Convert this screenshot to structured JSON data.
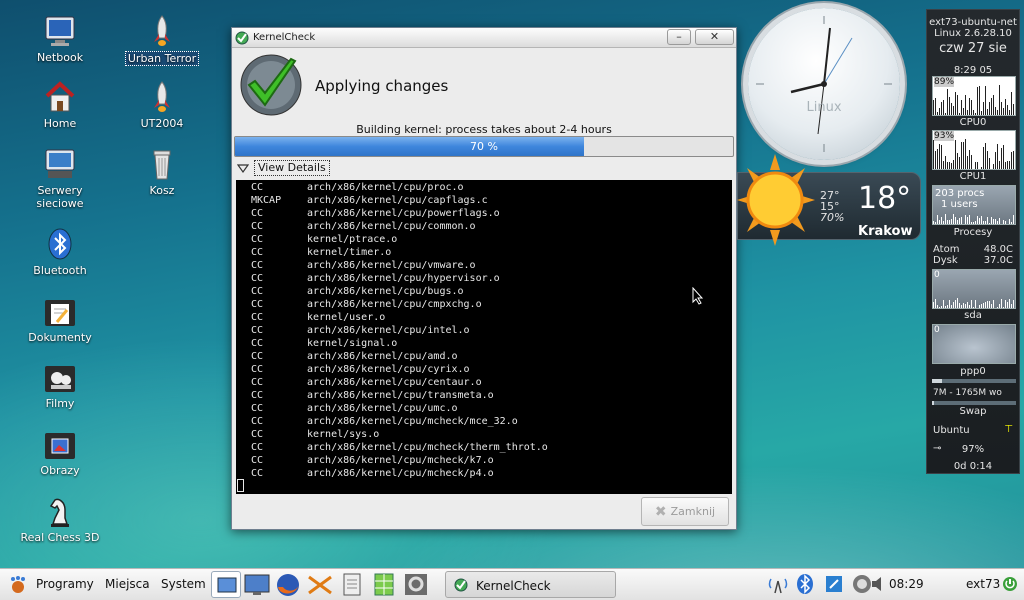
{
  "desktop": {
    "icons": [
      {
        "label": "Netbook"
      },
      {
        "label": "Urban Terror"
      },
      {
        "label": "Home"
      },
      {
        "label": "UT2004"
      },
      {
        "label": "Serwery sieciowe"
      },
      {
        "label": "Kosz"
      },
      {
        "label": "Bluetooth"
      },
      {
        "label": "Dokumenty"
      },
      {
        "label": "Filmy"
      },
      {
        "label": "Obrazy"
      },
      {
        "label": "Real Chess 3D"
      }
    ]
  },
  "window": {
    "title": "KernelCheck",
    "heading": "Applying changes",
    "status": "Building kernel: process takes about 2-4 hours",
    "progress": {
      "value": 0.7,
      "label": "70 %"
    },
    "expander_label": "View Details",
    "close_button": "Zamknij",
    "log": [
      [
        "CC",
        "arch/x86/kernel/cpu/proc.o"
      ],
      [
        "MKCAP",
        "arch/x86/kernel/cpu/capflags.c"
      ],
      [
        "CC",
        "arch/x86/kernel/cpu/powerflags.o"
      ],
      [
        "CC",
        "arch/x86/kernel/cpu/common.o"
      ],
      [
        "CC",
        "kernel/ptrace.o"
      ],
      [
        "CC",
        "kernel/timer.o"
      ],
      [
        "CC",
        "arch/x86/kernel/cpu/vmware.o"
      ],
      [
        "CC",
        "arch/x86/kernel/cpu/hypervisor.o"
      ],
      [
        "CC",
        "arch/x86/kernel/cpu/bugs.o"
      ],
      [
        "CC",
        "arch/x86/kernel/cpu/cmpxchg.o"
      ],
      [
        "CC",
        "kernel/user.o"
      ],
      [
        "CC",
        "arch/x86/kernel/cpu/intel.o"
      ],
      [
        "CC",
        "kernel/signal.o"
      ],
      [
        "CC",
        "arch/x86/kernel/cpu/amd.o"
      ],
      [
        "CC",
        "arch/x86/kernel/cpu/cyrix.o"
      ],
      [
        "CC",
        "arch/x86/kernel/cpu/centaur.o"
      ],
      [
        "CC",
        "arch/x86/kernel/cpu/transmeta.o"
      ],
      [
        "CC",
        "arch/x86/kernel/cpu/umc.o"
      ],
      [
        "CC",
        "arch/x86/kernel/cpu/mcheck/mce_32.o"
      ],
      [
        "CC",
        "kernel/sys.o"
      ],
      [
        "CC",
        "arch/x86/kernel/cpu/mcheck/therm_throt.o"
      ],
      [
        "CC",
        "arch/x86/kernel/cpu/mcheck/k7.o"
      ],
      [
        "CC",
        "arch/x86/kernel/cpu/mcheck/p4.o"
      ]
    ]
  },
  "clock": {
    "brand": "Linux",
    "time": "08:29"
  },
  "weather": {
    "high": "27°",
    "low": "15°",
    "humidity": "70%",
    "current": "18°",
    "city": "Krakow"
  },
  "monitor": {
    "host": "ext73-ubuntu-net",
    "kernel": "Linux 2.6.28.10",
    "date": "czw 27 sie",
    "time": "8:29 05",
    "cpu0_pct": "89%",
    "cpu0_label": "CPU0",
    "cpu1_pct": "93%",
    "cpu1_label": "CPU1",
    "procs": "203 procs",
    "users": "1 users",
    "procs_label": "Procesy",
    "atom_label": "Atom",
    "atom_temp": "48.0C",
    "disk_label": "Dysk",
    "disk_temp": "37.0C",
    "sda_scale": "0",
    "sda_label": "sda",
    "ppp_scale": "0",
    "ppp_label": "ppp0",
    "mem": "7M - 1765M wo",
    "swap_label": "Swap",
    "distro": "Ubuntu",
    "battery": "97%",
    "uptime": "0d  0:14"
  },
  "panel": {
    "menus": [
      "Programy",
      "Miejsca",
      "System"
    ],
    "task": "KernelCheck",
    "time": "08:29",
    "user": "ext73"
  }
}
